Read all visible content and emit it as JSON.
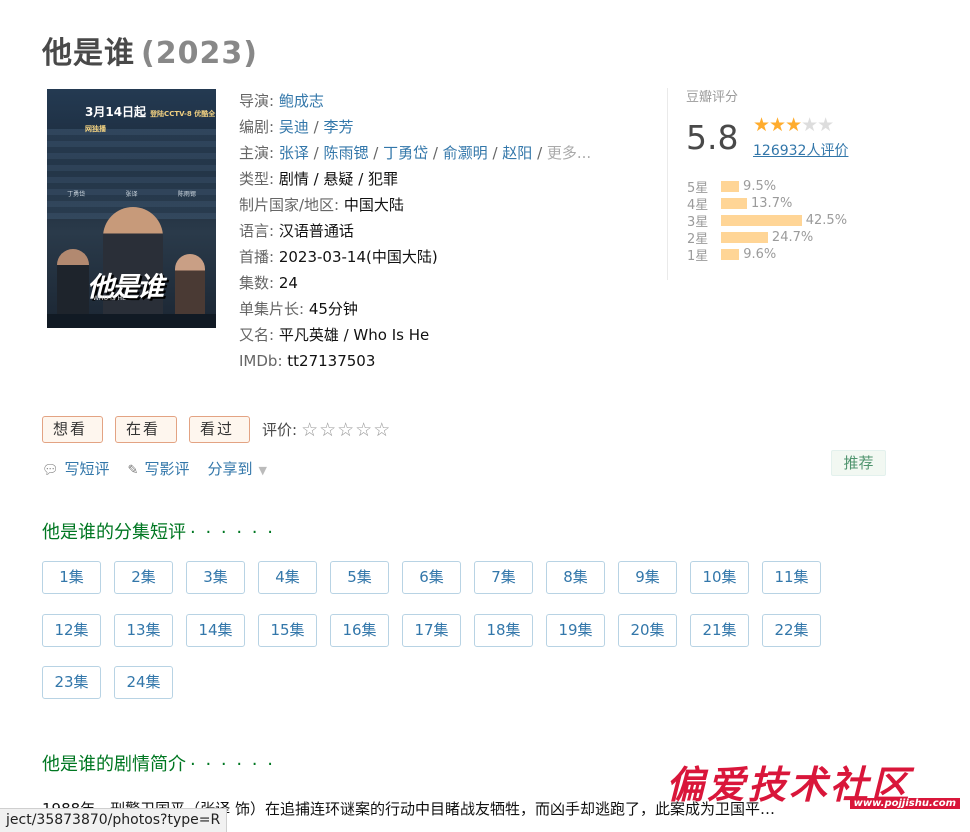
{
  "title": {
    "name": "他是谁",
    "year": "(2023)"
  },
  "info": {
    "director_label": "导演:",
    "director": [
      "鲍成志"
    ],
    "writer_label": "编剧:",
    "writers": [
      "吴迪",
      "李芳"
    ],
    "cast_label": "主演:",
    "cast": [
      "张译",
      "陈雨锶",
      "丁勇岱",
      "俞灏明",
      "赵阳"
    ],
    "cast_more": "更多...",
    "genre_label": "类型:",
    "genres": "剧情 / 悬疑 / 犯罪",
    "country_label": "制片国家/地区:",
    "country": "中国大陆",
    "language_label": "语言:",
    "language": "汉语普通话",
    "premiere_label": "首播:",
    "premiere": "2023-03-14(中国大陆)",
    "episodes_label": "集数:",
    "episodes": "24",
    "runtime_label": "单集片长:",
    "runtime": "45分钟",
    "aka_label": "又名:",
    "aka": "平凡英雄 / Who Is He",
    "imdb_label": "IMDb:",
    "imdb": "tt27137503"
  },
  "poster": {
    "date_text": "3月14日起",
    "side_text": "登陆CCTV-8 优酷全网独播",
    "logo_text": "他是谁",
    "sub_text": "WHO IS HE",
    "names": [
      "丁勇岱",
      "张译",
      "陈雨锶"
    ]
  },
  "rating": {
    "label": "豆瓣评分",
    "score": "5.8",
    "stars_on": "★★★",
    "stars_off": "★★",
    "votes": "126932人评价",
    "distribution": [
      {
        "label": "5星",
        "pct": "9.5%",
        "value": 9.5
      },
      {
        "label": "4星",
        "pct": "13.7%",
        "value": 13.7
      },
      {
        "label": "3星",
        "pct": "42.5%",
        "value": 42.5
      },
      {
        "label": "2星",
        "pct": "24.7%",
        "value": 24.7
      },
      {
        "label": "1星",
        "pct": "9.6%",
        "value": 9.6
      }
    ]
  },
  "actions": {
    "want": "想看",
    "watching": "在看",
    "watched": "看过",
    "rate_label": "评价:",
    "rate_stars": "☆☆☆☆☆",
    "short_review": "写短评",
    "review": "写影评",
    "share": "分享到",
    "recommend": "推荐"
  },
  "episodes_section": {
    "title": "他是谁的分集短评",
    "dots": "· · · · · ·",
    "items": [
      "1集",
      "2集",
      "3集",
      "4集",
      "5集",
      "6集",
      "7集",
      "8集",
      "9集",
      "10集",
      "11集",
      "12集",
      "13集",
      "14集",
      "15集",
      "16集",
      "17集",
      "18集",
      "19集",
      "20集",
      "21集",
      "22集",
      "23集",
      "24集"
    ]
  },
  "summary_section": {
    "title": "他是谁的剧情简介",
    "dots": "· · · · · ·",
    "text": "1988年，刑警卫国平（张译 饰）在追捕连环谜案的行动中目睹战友牺牲，而凶手却逃跑了，此案成为卫国平…"
  },
  "statusbar": "ject/35873870/photos?type=R",
  "watermark": {
    "text": "偏爱技术社区",
    "url": "www.pojjishu.com"
  }
}
